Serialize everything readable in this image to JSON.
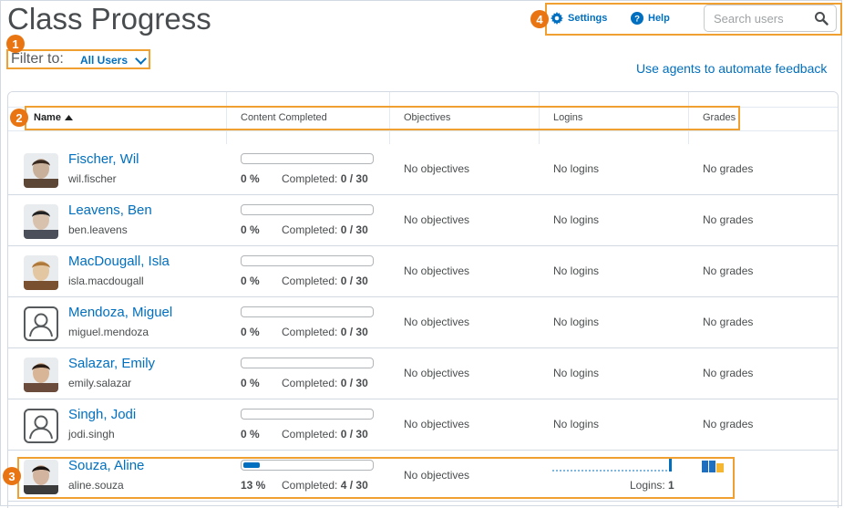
{
  "page": {
    "title": "Class Progress"
  },
  "callouts": [
    "1",
    "2",
    "3",
    "4"
  ],
  "filter": {
    "label": "Filter to:",
    "value": "All Users"
  },
  "toolbar": {
    "settings_label": "Settings",
    "help_label": "Help"
  },
  "search": {
    "placeholder": "Search users"
  },
  "agents_link": "Use agents to automate feedback",
  "columns": {
    "name": "Name",
    "content": "Content Completed",
    "objectives": "Objectives",
    "logins": "Logins",
    "grades": "Grades"
  },
  "users": [
    {
      "name": "Fischer, Wil",
      "username": "wil.fischer",
      "percent": "0 %",
      "completed_label": "Completed:",
      "completed": "0 / 30",
      "progress": 0,
      "objectives": "No objectives",
      "logins": "No logins",
      "grades": "No grades",
      "avatar": "photo"
    },
    {
      "name": "Leavens, Ben",
      "username": "ben.leavens",
      "percent": "0 %",
      "completed_label": "Completed:",
      "completed": "0 / 30",
      "progress": 0,
      "objectives": "No objectives",
      "logins": "No logins",
      "grades": "No grades",
      "avatar": "photo"
    },
    {
      "name": "MacDougall, Isla",
      "username": "isla.macdougall",
      "percent": "0 %",
      "completed_label": "Completed:",
      "completed": "0 / 30",
      "progress": 0,
      "objectives": "No objectives",
      "logins": "No logins",
      "grades": "No grades",
      "avatar": "photo"
    },
    {
      "name": "Mendoza, Miguel",
      "username": "miguel.mendoza",
      "percent": "0 %",
      "completed_label": "Completed:",
      "completed": "0 / 30",
      "progress": 0,
      "objectives": "No objectives",
      "logins": "No logins",
      "grades": "No grades",
      "avatar": "placeholder"
    },
    {
      "name": "Salazar, Emily",
      "username": "emily.salazar",
      "percent": "0 %",
      "completed_label": "Completed:",
      "completed": "0 / 30",
      "progress": 0,
      "objectives": "No objectives",
      "logins": "No logins",
      "grades": "No grades",
      "avatar": "photo"
    },
    {
      "name": "Singh, Jodi",
      "username": "jodi.singh",
      "percent": "0 %",
      "completed_label": "Completed:",
      "completed": "0 / 30",
      "progress": 0,
      "objectives": "No objectives",
      "logins": "No logins",
      "grades": "No grades",
      "avatar": "placeholder"
    },
    {
      "name": "Souza, Aline",
      "username": "aline.souza",
      "percent": "13 %",
      "completed_label": "Completed:",
      "completed": "4 / 30",
      "progress": 0.13,
      "objectives": "No objectives",
      "logins_label": "Logins:",
      "logins_count": "1",
      "avatar": "photo"
    }
  ],
  "colors": {
    "accent": "#006fbf",
    "callout": "#e87511",
    "highlight": "#f0a030",
    "grade_blue": "#1f6fc0",
    "grade_orange": "#f5b731"
  },
  "icons": {
    "settings": "gear-icon",
    "help": "help-icon",
    "search": "search-icon",
    "sort": "sort-ascending-icon",
    "placeholder_avatar": "user-placeholder-icon"
  }
}
